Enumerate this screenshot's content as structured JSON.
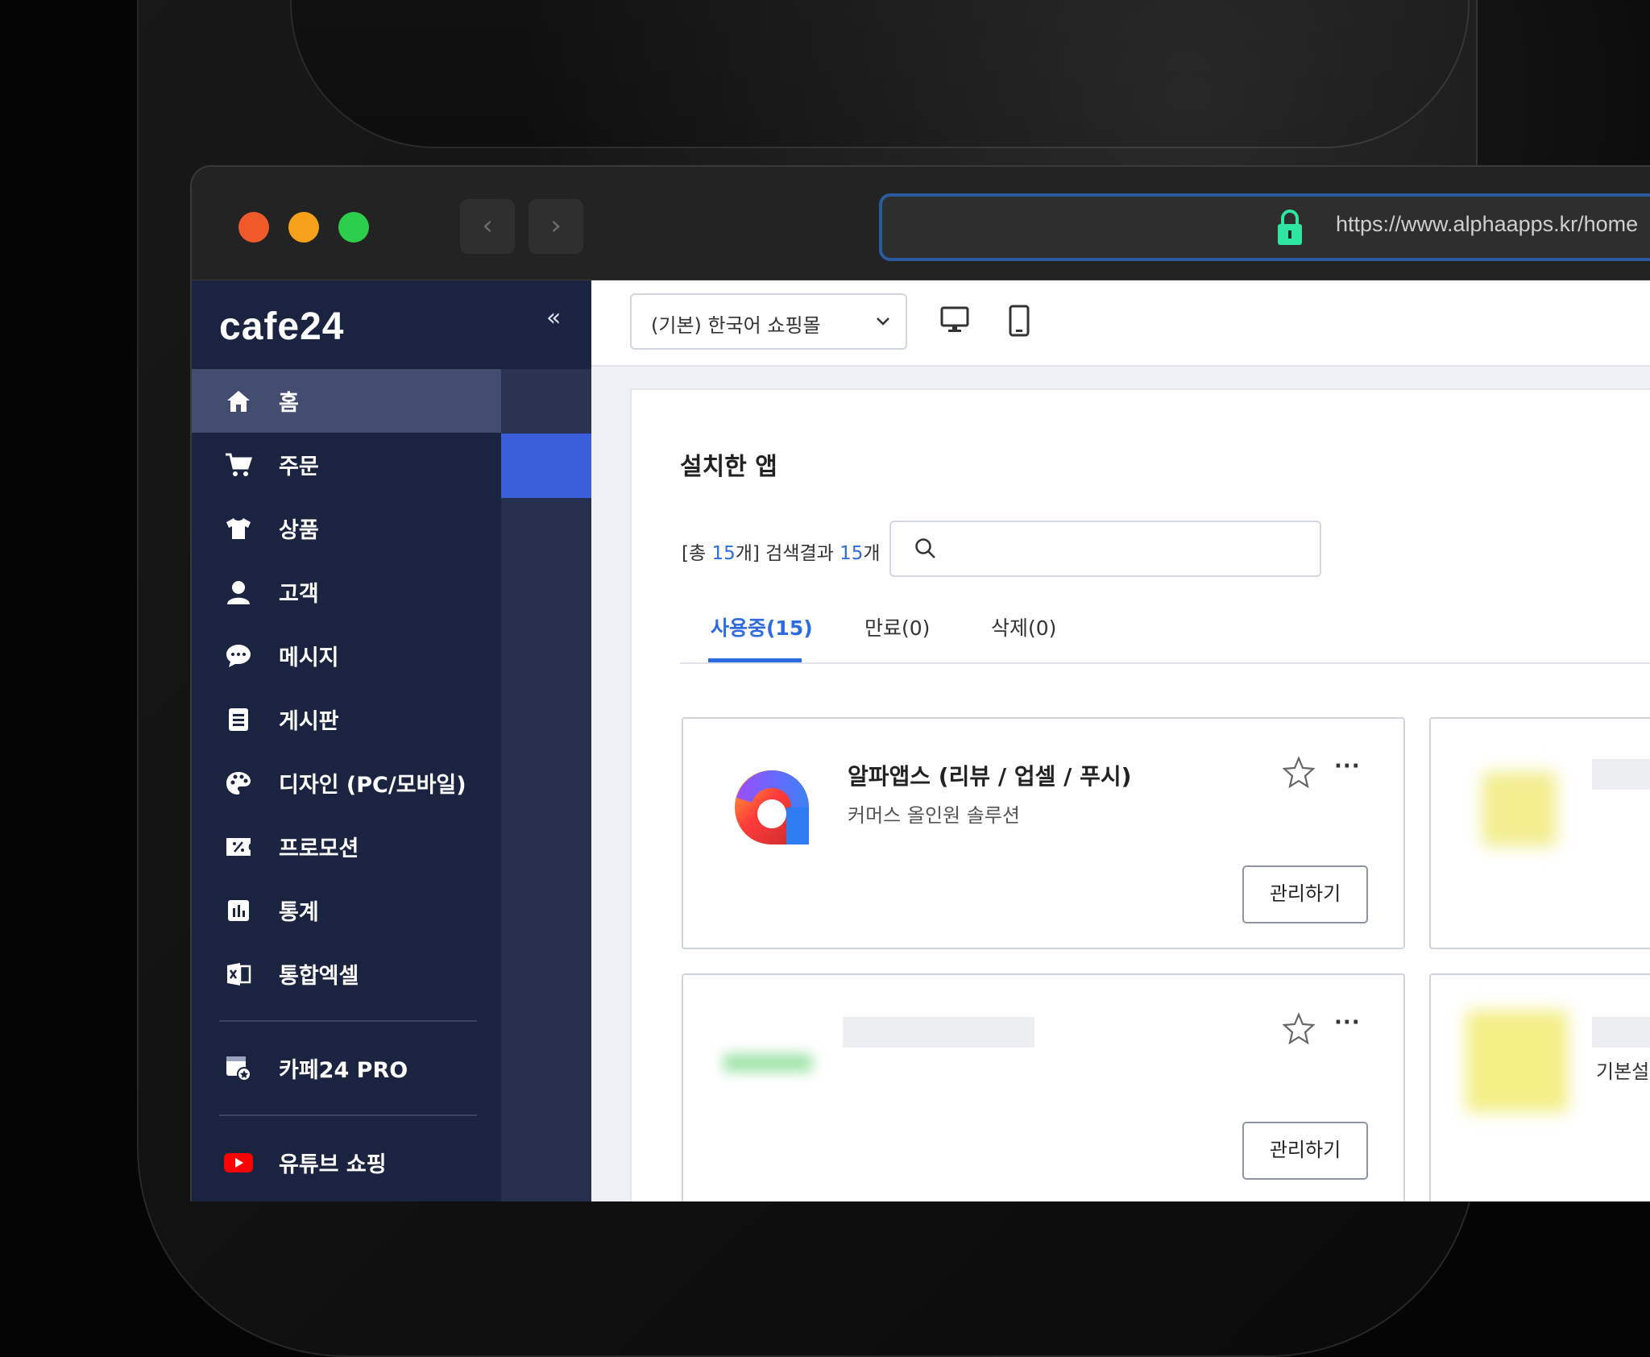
{
  "browser": {
    "url": "https://www.alphaapps.kr/home",
    "back_icon": "‹",
    "forward_icon": "›"
  },
  "sidebar": {
    "brand": "cafe24",
    "collapse_icon": "«",
    "items": [
      {
        "label": "홈",
        "icon": "home-icon",
        "active": true
      },
      {
        "label": "주문",
        "icon": "cart-icon"
      },
      {
        "label": "상품",
        "icon": "shirt-icon"
      },
      {
        "label": "고객",
        "icon": "user-icon"
      },
      {
        "label": "메시지",
        "icon": "chat-icon"
      },
      {
        "label": "게시판",
        "icon": "board-icon"
      },
      {
        "label": "디자인 (PC/모바일)",
        "icon": "palette-icon"
      },
      {
        "label": "프로모션",
        "icon": "coupon-icon"
      },
      {
        "label": "통계",
        "icon": "stats-icon"
      },
      {
        "label": "통합엑셀",
        "icon": "excel-icon"
      }
    ],
    "pro": {
      "label": "카페24 PRO",
      "icon": "pro-icon"
    },
    "youtube": {
      "label": "유튜브 쇼핑",
      "icon": "youtube-icon"
    }
  },
  "topbar": {
    "store_select": "(기본) 한국어 쇼핑몰",
    "chevron": "⌄",
    "pc_icon": "monitor-icon",
    "mobile_icon": "mobile-icon"
  },
  "main": {
    "title": "설치한 앱",
    "count_prefix": "[총 ",
    "total": "15",
    "count_mid": "개] 검색결과 ",
    "results": "15",
    "count_suffix": "개",
    "search_placeholder": "",
    "tabs": [
      {
        "label": "사용중(15)",
        "active": true
      },
      {
        "label": "만료(0)"
      },
      {
        "label": "삭제(0)"
      }
    ],
    "cards": [
      {
        "name": "알파앱스 (리뷰 / 업셀 / 푸시)",
        "desc": "커머스 올인원 솔루션",
        "button": "관리하기",
        "more": "···"
      },
      {
        "name": "",
        "desc": "",
        "button": "관리하기",
        "more": "···"
      }
    ],
    "side_card_text": "기본설"
  },
  "colors": {
    "accent": "#2d6be0",
    "sidebar_bg": "#1a2340",
    "sidebar_highlight": "#3a5fd8",
    "lock": "#2ee6a0"
  }
}
